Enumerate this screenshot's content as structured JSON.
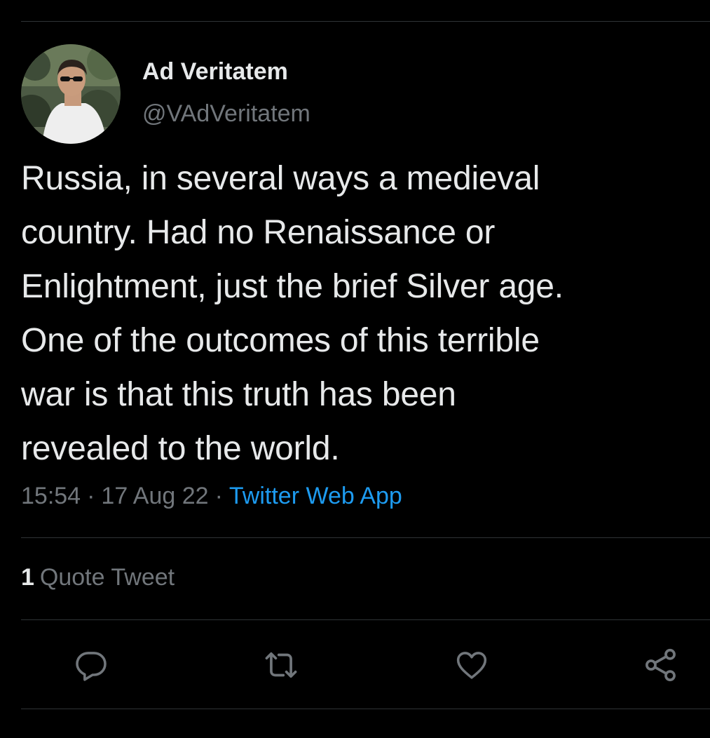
{
  "author": {
    "display_name": "Ad Veritatem",
    "handle": "@VAdVeritatem"
  },
  "tweet": {
    "text": "Russia, in several ways a medieval\ncountry. Had no Renaissance or\nEnlightment, just the brief Silver age.\nOne of the outcomes of this terrible\nwar is that this truth has been\nrevealed to the world.",
    "time": "15:54",
    "date": "17 Aug 22",
    "separator": "·",
    "source": "Twitter Web App"
  },
  "stats": {
    "quote_count": "1",
    "quote_label": "Quote Tweet"
  },
  "actions": [
    {
      "name": "reply",
      "icon": "reply-icon"
    },
    {
      "name": "retweet",
      "icon": "retweet-icon"
    },
    {
      "name": "like",
      "icon": "like-icon"
    },
    {
      "name": "share",
      "icon": "share-icon"
    }
  ],
  "colors": {
    "background": "#000000",
    "text_primary": "#e7e9ea",
    "text_secondary": "#71767b",
    "link": "#1d9bf0",
    "divider": "#2f3336"
  }
}
